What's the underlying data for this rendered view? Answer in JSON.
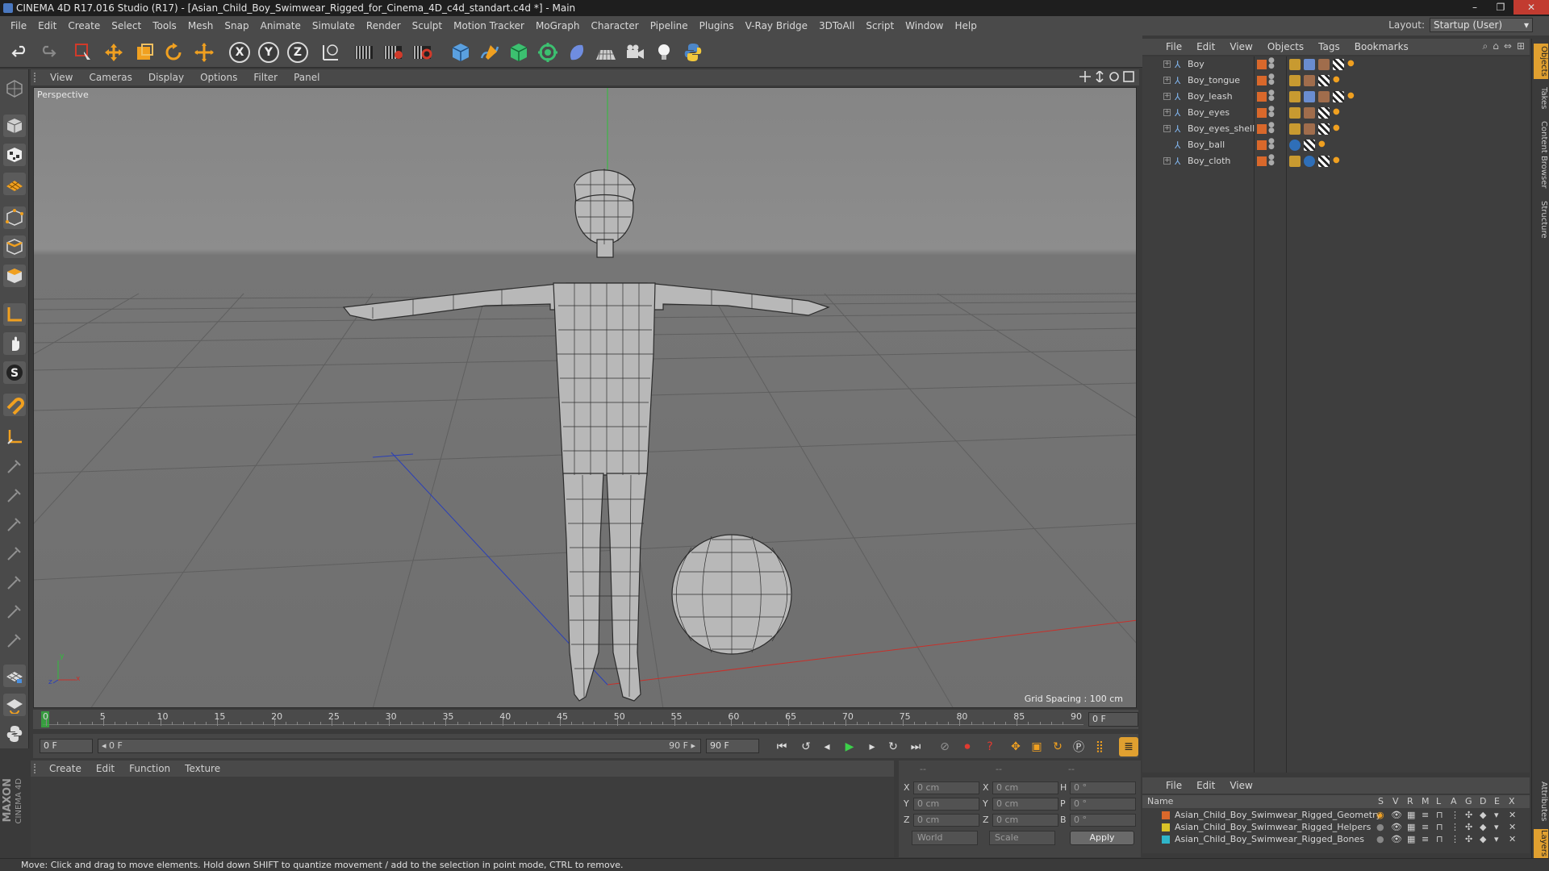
{
  "window": {
    "title": "CINEMA 4D R17.016 Studio (R17) - [Asian_Child_Boy_Swimwear_Rigged_for_Cinema_4D_c4d_standart.c4d *] - Main",
    "controls": [
      "–",
      "❐",
      "✕"
    ]
  },
  "menubar": {
    "items": [
      "File",
      "Edit",
      "Create",
      "Select",
      "Tools",
      "Mesh",
      "Snap",
      "Animate",
      "Simulate",
      "Render",
      "Sculpt",
      "Motion Tracker",
      "MoGraph",
      "Character",
      "Pipeline",
      "Plugins",
      "V-Ray Bridge",
      "3DToAll",
      "Script",
      "Window",
      "Help"
    ],
    "layout_label": "Layout:",
    "layout_value": "Startup (User)"
  },
  "toolbar": {
    "axis_x": "X",
    "axis_y": "Y",
    "axis_z": "Z"
  },
  "viewport": {
    "menu": [
      "View",
      "Cameras",
      "Display",
      "Options",
      "Filter",
      "Panel"
    ],
    "label": "Perspective",
    "grid_spacing": "Grid Spacing : 100 cm",
    "axis_gizmo": {
      "y": "y",
      "z": "z",
      "x": "x"
    }
  },
  "timeline": {
    "ticks": [
      "0",
      "5",
      "10",
      "15",
      "20",
      "25",
      "30",
      "35",
      "40",
      "45",
      "50",
      "55",
      "60",
      "65",
      "70",
      "75",
      "80",
      "85",
      "90"
    ],
    "current_frame_right": "0 F",
    "start_field": "0 F",
    "range_start": "◂ 0 F",
    "range_end": "90 F ▸",
    "end_field": "90 F"
  },
  "material_panel": {
    "menu": [
      "Create",
      "Edit",
      "Function",
      "Texture"
    ]
  },
  "coords": {
    "headers": [
      "--",
      "--",
      "--"
    ],
    "rows": [
      {
        "l1": "X",
        "v1": "0 cm",
        "l2": "X",
        "v2": "0 cm",
        "l3": "H",
        "v3": "0 °"
      },
      {
        "l1": "Y",
        "v1": "0 cm",
        "l2": "Y",
        "v2": "0 cm",
        "l3": "P",
        "v3": "0 °"
      },
      {
        "l1": "Z",
        "v1": "0 cm",
        "l2": "Z",
        "v2": "0 cm",
        "l3": "B",
        "v3": "0 °"
      }
    ],
    "space_select": "World",
    "mode_select": "Scale",
    "apply_label": "Apply"
  },
  "object_manager": {
    "menu": [
      "File",
      "Edit",
      "View",
      "Objects",
      "Tags",
      "Bookmarks"
    ],
    "objects": [
      {
        "name": "Boy"
      },
      {
        "name": "Boy_tongue"
      },
      {
        "name": "Boy_leash"
      },
      {
        "name": "Boy_eyes"
      },
      {
        "name": "Boy_eyes_shell"
      },
      {
        "name": "Boy_ball"
      },
      {
        "name": "Boy_cloth"
      }
    ]
  },
  "layer_manager": {
    "menu": [
      "File",
      "Edit",
      "View"
    ],
    "columns": [
      "Name",
      "S",
      "V",
      "R",
      "M",
      "L",
      "A",
      "G",
      "D",
      "E",
      "X"
    ],
    "layers": [
      {
        "name": "Asian_Child_Boy_Swimwear_Rigged_Geometry",
        "color": "#d9682b"
      },
      {
        "name": "Asian_Child_Boy_Swimwear_Rigged_Helpers",
        "color": "#d8c227"
      },
      {
        "name": "Asian_Child_Boy_Swimwear_Rigged_Bones",
        "color": "#2fb5c9"
      }
    ]
  },
  "side_tabs": [
    "Objects",
    "Takes",
    "Content Browser",
    "Structure",
    "Attributes",
    "Layers"
  ],
  "logo": {
    "line1": "MAXON",
    "line2": "CINEMA 4D"
  },
  "status": "Move: Click and drag to move elements. Hold down SHIFT to quantize movement / add to the selection in point mode, CTRL to remove."
}
